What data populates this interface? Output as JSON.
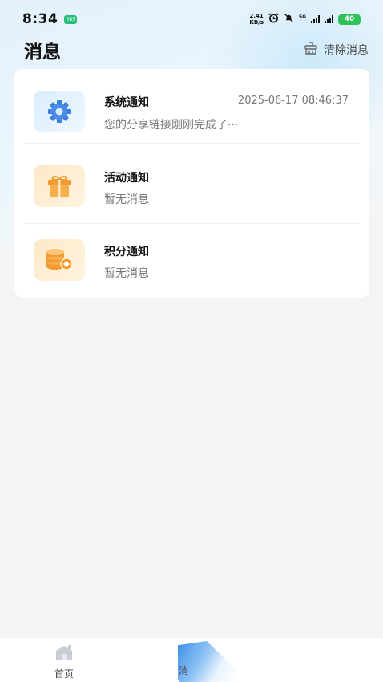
{
  "status_bar": {
    "time": "8:34",
    "app_badge": "365",
    "net_speed_value": "2.41",
    "net_speed_unit": "KB/s",
    "signal_label": "5G",
    "battery": "40"
  },
  "header": {
    "title": "消息",
    "clear_label": "清除消息"
  },
  "messages": [
    {
      "icon": "gear-icon",
      "title": "系统通知",
      "time": "2025-06-17 08:46:37",
      "subtitle": "您的分享链接刚刚完成了···"
    },
    {
      "icon": "gift-icon",
      "title": "活动通知",
      "subtitle": "暂无消息"
    },
    {
      "icon": "coins-icon",
      "title": "积分通知",
      "subtitle": "暂无消息"
    }
  ],
  "tabbar": {
    "home_label": "首页",
    "messages_label": "消"
  },
  "colors": {
    "accent": "#3b8ee8",
    "orange": "#f39a30",
    "background": "#f4f4f5"
  }
}
